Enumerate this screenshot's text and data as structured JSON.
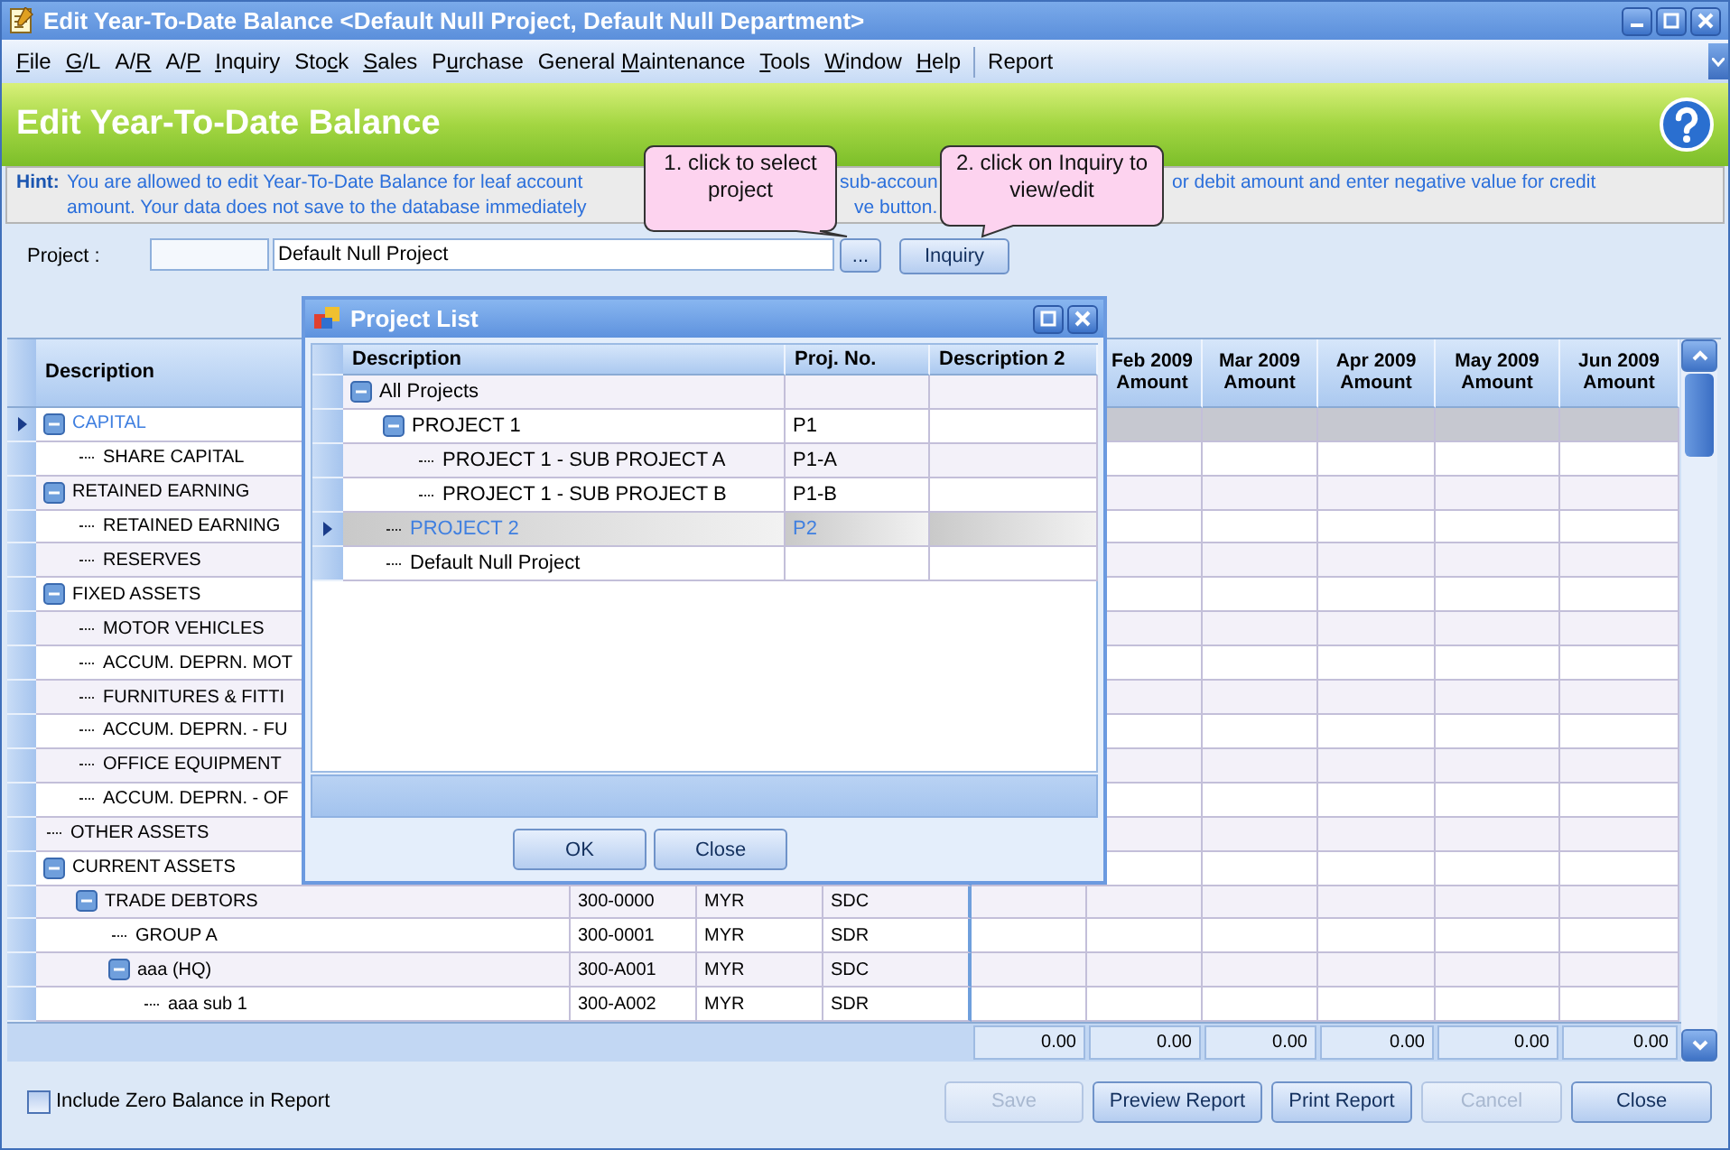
{
  "window": {
    "title": "Edit Year-To-Date Balance <Default Null Project, Default Null Department>"
  },
  "menu": [
    {
      "kind": "mnemonic",
      "key": "F",
      "post": "ile"
    },
    {
      "kind": "mnemonic",
      "key": "G",
      "post": "/L"
    },
    {
      "kind": "mnemonic",
      "pre": "A/",
      "key": "R"
    },
    {
      "kind": "mnemonic",
      "pre": "A/",
      "key": "P"
    },
    {
      "kind": "mnemonic",
      "key": "I",
      "post": "nquiry"
    },
    {
      "kind": "mnemonic",
      "pre": "Sto",
      "key": "c",
      "post": "k"
    },
    {
      "kind": "mnemonic",
      "key": "S",
      "post": "ales"
    },
    {
      "kind": "mnemonic",
      "pre": "P",
      "key": "u",
      "post": "rchase"
    },
    {
      "kind": "mnemonic",
      "pre": "General ",
      "key": "M",
      "post": "aintenance"
    },
    {
      "kind": "mnemonic",
      "key": "T",
      "post": "ools"
    },
    {
      "kind": "mnemonic",
      "key": "W",
      "post": "indow"
    },
    {
      "kind": "mnemonic",
      "key": "H",
      "post": "elp"
    },
    {
      "kind": "separated",
      "label": "Report"
    }
  ],
  "header": {
    "title": "Edit Year-To-Date Balance"
  },
  "hint": {
    "label": "Hint:",
    "lines": [
      [
        "You are allowed to edit Year-To-Date Balance for leaf account",
        "sub-accoun",
        "or debit amount and enter negative value for credit"
      ],
      [
        "amount. Your data does not save to the database immediately",
        "ve button."
      ]
    ]
  },
  "callouts": [
    {
      "text": "1. click to select project"
    },
    {
      "text": "2. click on Inquiry to view/edit"
    }
  ],
  "project": {
    "label": "Project :",
    "value": "Default Null Project",
    "browse_button": "...",
    "inquiry_button": "Inquiry"
  },
  "grid": {
    "description_header": "Description",
    "month_headers": [
      "Feb 2009 Amount",
      "Mar 2009 Amount",
      "Apr 2009 Amount",
      "May 2009 Amount",
      "Jun 2009 Amount"
    ],
    "rows": [
      {
        "description": "CAPITAL",
        "selected": true,
        "expanded": true,
        "children": [
          {
            "description": "SHARE CAPITAL",
            "selected": false
          }
        ]
      },
      {
        "description": "RETAINED EARNING",
        "selected": false,
        "expanded": true,
        "children": [
          {
            "description": "RETAINED EARNING",
            "selected": false
          },
          {
            "description": "RESERVES",
            "selected": false
          }
        ]
      },
      {
        "description": "FIXED ASSETS",
        "selected": false,
        "expanded": true,
        "children": [
          {
            "description": "MOTOR VEHICLES",
            "selected": false
          },
          {
            "description": "ACCUM. DEPRN. MOT",
            "selected": false
          },
          {
            "description": "FURNITURES & FITTI",
            "selected": false
          },
          {
            "description": "ACCUM. DEPRN. - FU",
            "selected": false
          },
          {
            "description": "OFFICE EQUIPMENT",
            "selected": false
          },
          {
            "description": "ACCUM. DEPRN. - OF",
            "selected": false
          }
        ]
      },
      {
        "description": "OTHER ASSETS",
        "selected": false
      },
      {
        "description": "CURRENT ASSETS",
        "selected": false,
        "expanded": true,
        "children": [
          {
            "description": "TRADE DEBTORS",
            "code": "300-0000",
            "currency": "MYR",
            "type": "SDC",
            "selected": false,
            "expanded": true,
            "children": [
              {
                "description": "GROUP A",
                "code": "300-0001",
                "currency": "MYR",
                "type": "SDR",
                "selected": false
              },
              {
                "description": "aaa (HQ)",
                "code": "300-A001",
                "currency": "MYR",
                "type": "SDC",
                "selected": false,
                "expanded": true,
                "children": [
                  {
                    "description": "aaa sub 1",
                    "code": "300-A002",
                    "currency": "MYR",
                    "type": "SDR",
                    "selected": false
                  }
                ]
              }
            ]
          }
        ]
      }
    ],
    "totals": [
      "0.00",
      "0.00",
      "0.00",
      "0.00",
      "0.00",
      "0.00"
    ]
  },
  "dialog": {
    "title": "Project List",
    "columns": [
      "Description",
      "Proj. No.",
      "Description 2"
    ],
    "rows": [
      {
        "description": "All Projects",
        "selected": false,
        "expanded": true,
        "children": [
          {
            "description": "PROJECT 1",
            "proj_no": "P1",
            "selected": false,
            "expanded": true,
            "children": [
              {
                "description": "PROJECT 1 - SUB PROJECT A",
                "proj_no": "P1-A",
                "selected": false
              },
              {
                "description": "PROJECT 1 - SUB PROJECT B",
                "proj_no": "P1-B",
                "selected": false
              }
            ]
          },
          {
            "description": "PROJECT 2",
            "proj_no": "P2",
            "selected": true
          },
          {
            "description": "Default Null Project",
            "selected": false
          }
        ]
      }
    ],
    "buttons": [
      "OK",
      "Close"
    ]
  },
  "footer": {
    "checkbox": {
      "label": "Include Zero Balance in Report",
      "checked": false
    },
    "buttons": [
      {
        "label": "Save",
        "disabled": true
      },
      {
        "label": "Preview Report",
        "disabled": false
      },
      {
        "label": "Print Report",
        "disabled": false
      },
      {
        "label": "Cancel",
        "disabled": true
      },
      {
        "label": "Close",
        "disabled": false
      }
    ]
  }
}
